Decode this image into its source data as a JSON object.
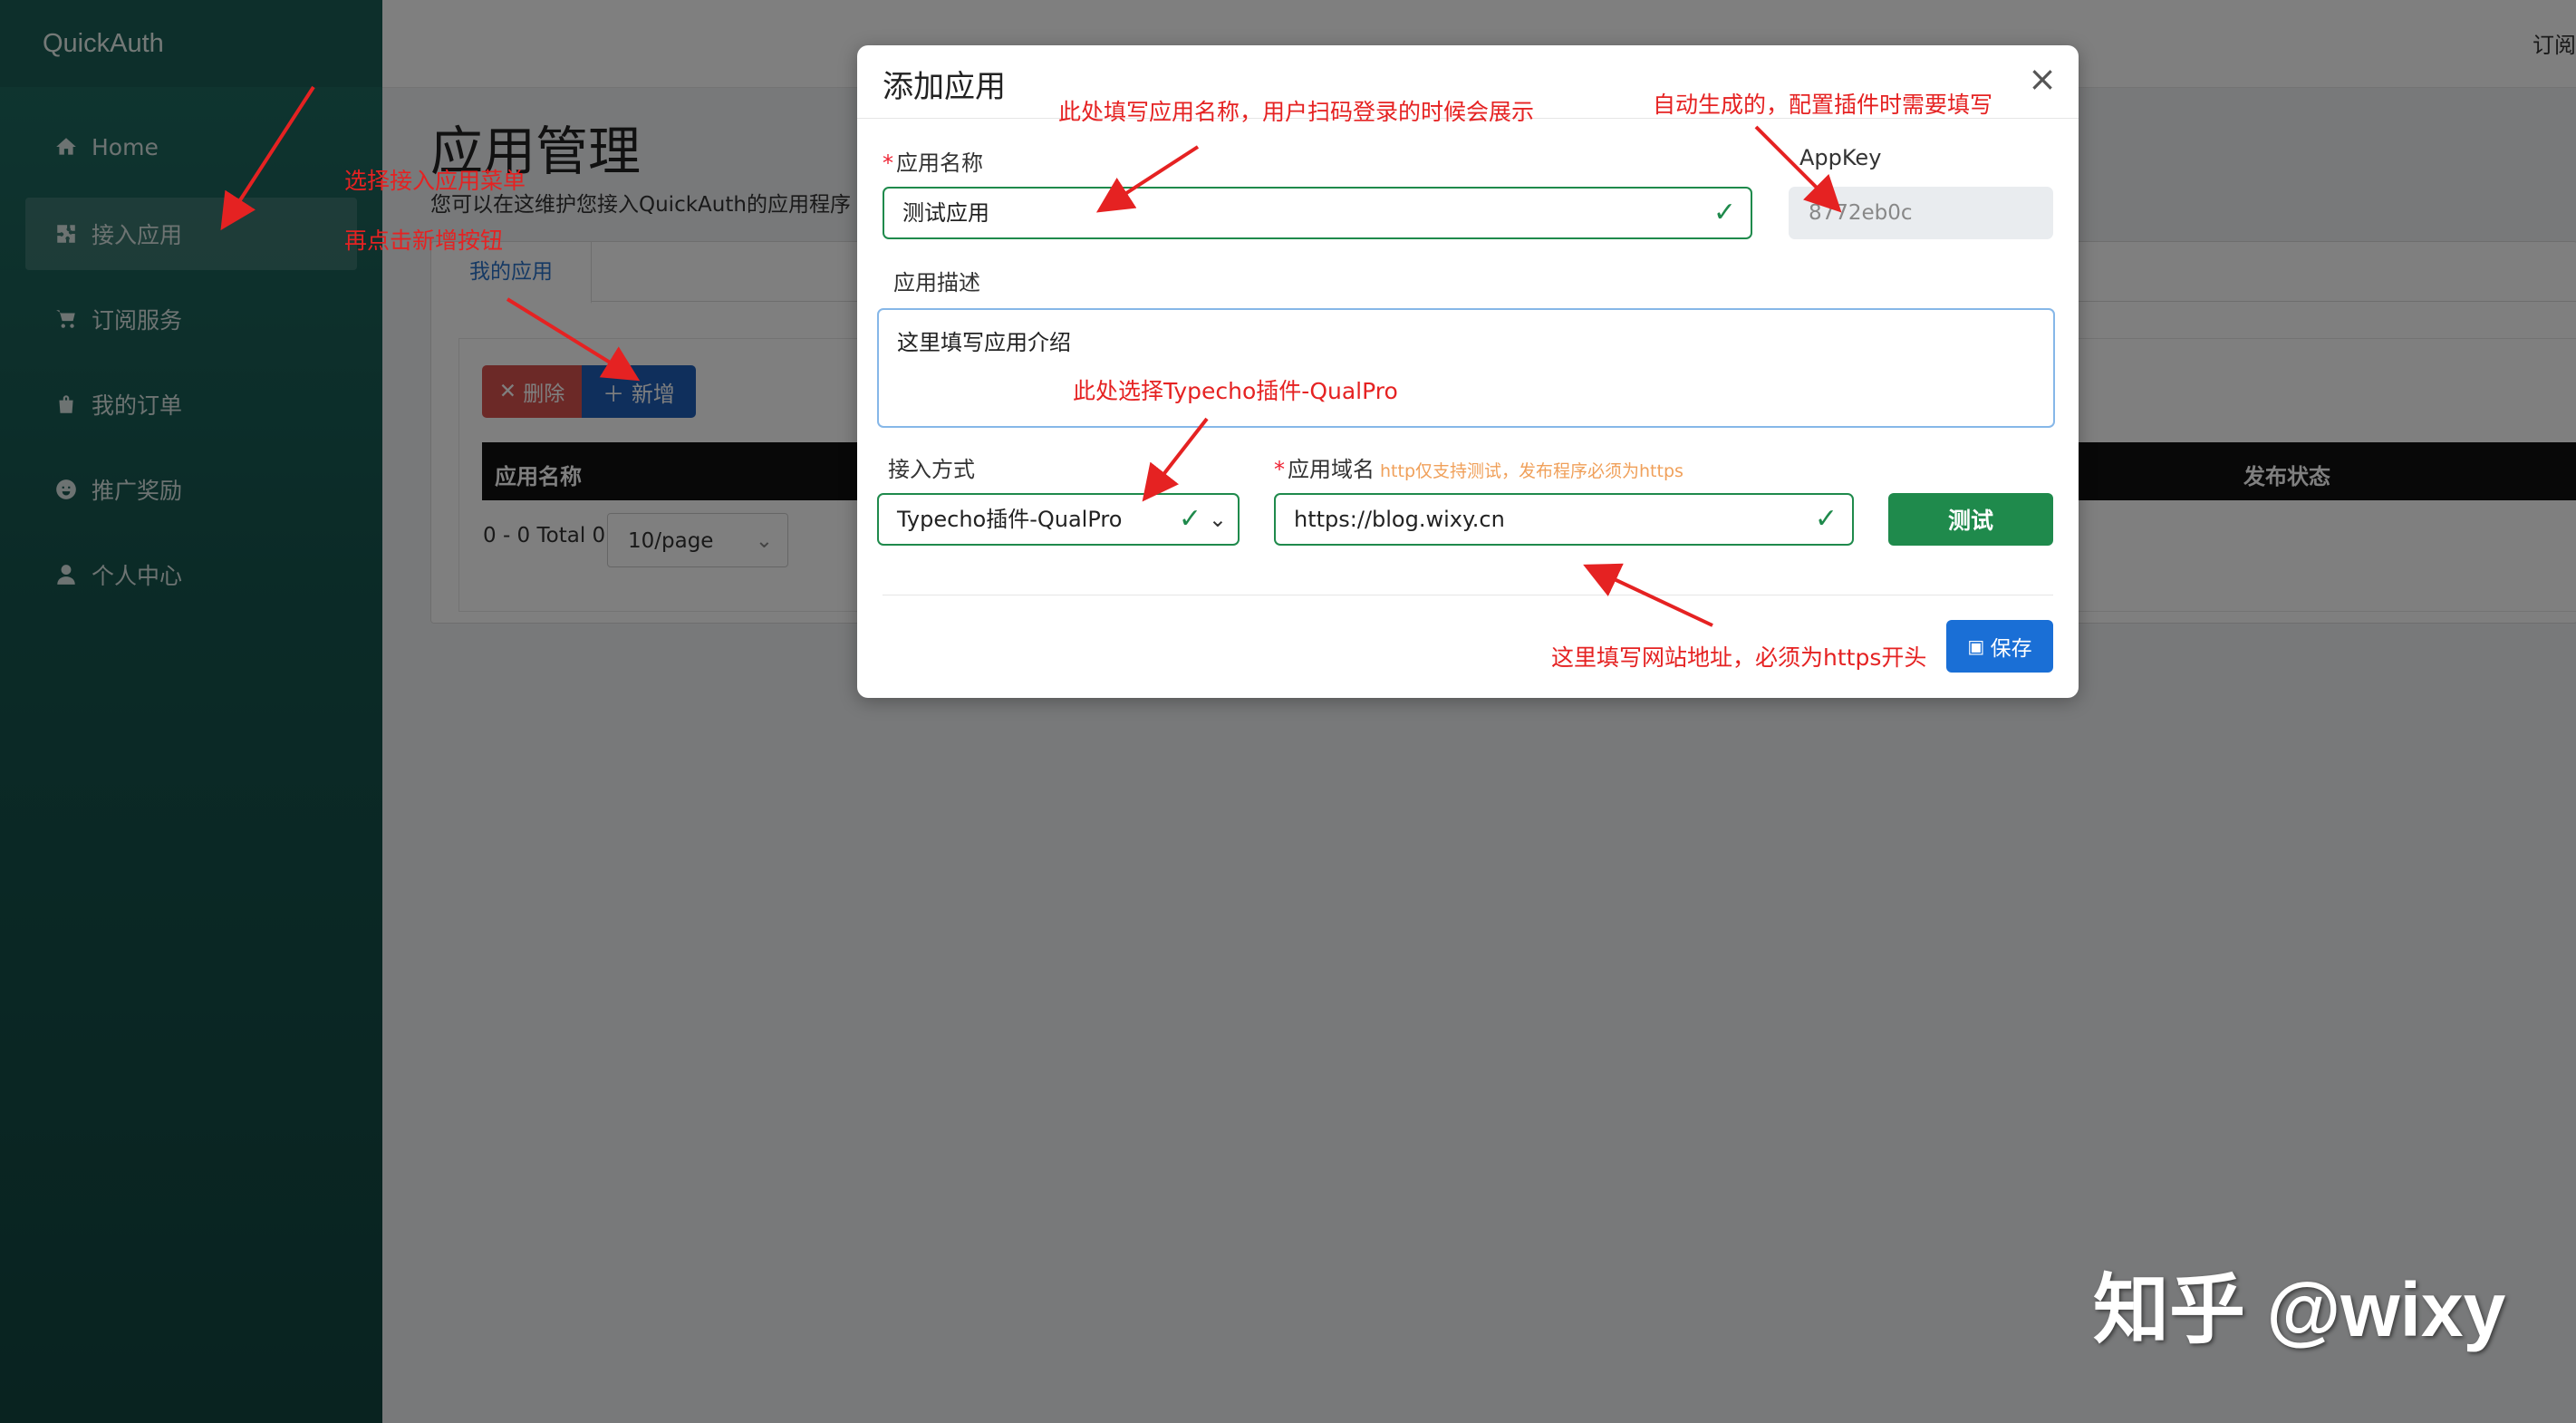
{
  "sidebar": {
    "brand": "QuickAuth",
    "items": [
      {
        "label": "Home",
        "icon": "home-icon"
      },
      {
        "label": "接入应用",
        "icon": "puzzle-icon"
      },
      {
        "label": "订阅服务",
        "icon": "cart-icon"
      },
      {
        "label": "我的订单",
        "icon": "bag-icon"
      },
      {
        "label": "推广奖励",
        "icon": "smile-icon"
      },
      {
        "label": "个人中心",
        "icon": "user-icon"
      }
    ]
  },
  "header": {
    "right_text": "订阅"
  },
  "main": {
    "title": "应用管理",
    "description": "您可以在这维护您接入QuickAuth的应用程序",
    "tab": "我的应用",
    "delete_label": "删除",
    "add_label": "新增",
    "table_headers": [
      "应用名称",
      "发布状态"
    ],
    "pager_text": "0 - 0 Total 0",
    "page_size": "10/page"
  },
  "modal": {
    "title": "添加应用",
    "app_name_label": "应用名称",
    "app_name_value": "测试应用",
    "appkey_label": "AppKey",
    "appkey_value": "8772eb0c",
    "desc_label": "应用描述",
    "desc_value": "这里填写应用介绍",
    "access_label": "接入方式",
    "access_value": "Typecho插件-QualPro",
    "domain_label": "应用域名",
    "domain_hint": "http仅支持测试，发布程序必须为https",
    "domain_value": "https://blog.wixy.cn",
    "test_label": "测试",
    "save_label": "保存"
  },
  "annotations": {
    "select_menu": "选择接入应用菜单",
    "click_add": "再点击新增按钮",
    "fill_name": "此处填写应用名称，用户扫码登录的时候会展示",
    "auto_key": "自动生成的，配置插件时需要填写",
    "select_plugin": "此处选择Typecho插件-QualPro",
    "fill_url": "这里填写网站地址，必须为https开头"
  },
  "watermark": "知乎 @wixy",
  "colors": {
    "sidebar": "#17564f",
    "primary_green": "#1f8a4c",
    "primary_blue": "#1a6fd6",
    "annotation_red": "#e52222"
  }
}
